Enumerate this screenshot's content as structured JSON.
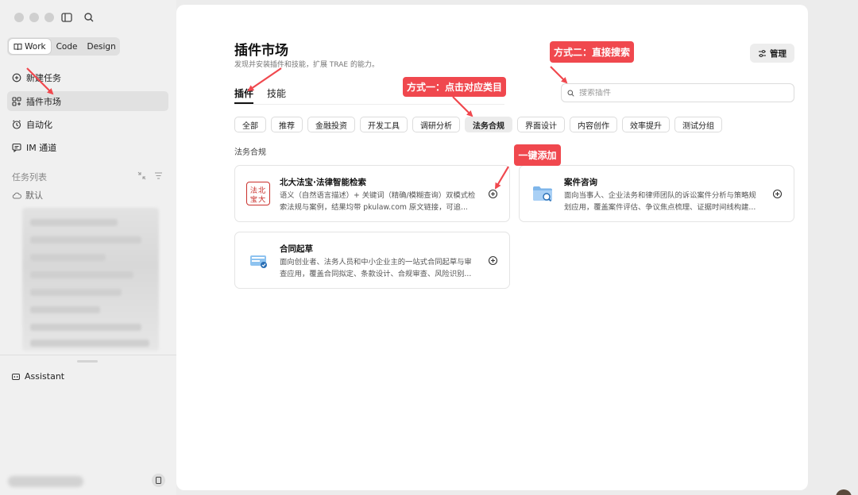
{
  "sidebar": {
    "mode_tabs": [
      {
        "label": "Work",
        "active": true
      },
      {
        "label": "Code",
        "active": false
      },
      {
        "label": "Design",
        "active": false
      }
    ],
    "nav": [
      {
        "label": "新建任务",
        "icon": "new-task-icon"
      },
      {
        "label": "插件市场",
        "icon": "plugins-icon",
        "active": true
      },
      {
        "label": "自动化",
        "icon": "clock-icon"
      },
      {
        "label": "IM 通道",
        "icon": "chat-icon"
      }
    ],
    "task_list_label": "任务列表",
    "default_label": "默认",
    "assistant_label": "Assistant"
  },
  "main": {
    "title": "插件市场",
    "subtitle": "发现并安装插件和技能，扩展 TRAE 的能力。",
    "manage_label": "管理",
    "tabs": [
      {
        "label": "插件",
        "active": true
      },
      {
        "label": "技能",
        "active": false
      }
    ],
    "search_placeholder": "搜索插件",
    "categories": [
      "全部",
      "推荐",
      "金融投资",
      "开发工具",
      "调研分析",
      "法务合规",
      "界面设计",
      "内容创作",
      "效率提升",
      "测试分组"
    ],
    "active_category": "法务合规",
    "section_title": "法务合规",
    "plugins": [
      {
        "name": "北大法宝·法律智能检索",
        "desc": "语义（自然语言描述）+ 关键词（精确/模糊查询）双模式检索法规与案例，结果均带 pkulaw.com 原文链接，可追...",
        "logo_text": "法北宝大"
      },
      {
        "name": "案件咨询",
        "desc": "面向当事人、企业法务和律师团队的诉讼案件分析与策略规划应用，覆盖案件评估、争议焦点梳理、证据时间线构建..."
      },
      {
        "name": "合同起草",
        "desc": "面向创业者、法务人员和中小企业主的一站式合同起草与审查应用，覆盖合同拟定、条款设计、合规审查、风险识别..."
      }
    ]
  },
  "annotations": {
    "method_two": "方式二：直接搜索",
    "method_one": "方式一：点击对应类目",
    "one_click_add": "一键添加"
  },
  "colors": {
    "annotation_red": "#f0484e",
    "sidebar_bg": "#f0f0f0",
    "panel_bg": "#ffffff"
  }
}
